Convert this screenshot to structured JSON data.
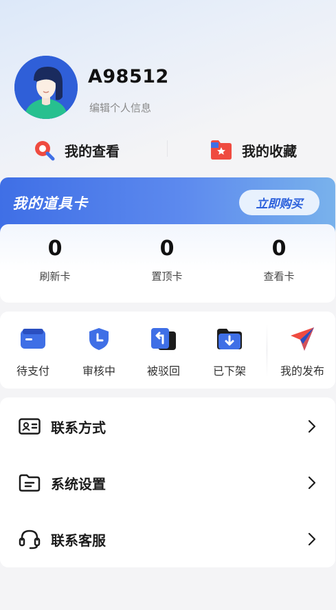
{
  "profile": {
    "username": "A98512",
    "edit_label": "编辑个人信息"
  },
  "quick_links": {
    "views_label": "我的查看",
    "favorites_label": "我的收藏"
  },
  "props": {
    "title": "我的道具卡",
    "buy_label": "立即购买",
    "stats": [
      {
        "value": "0",
        "label": "刷新卡"
      },
      {
        "value": "0",
        "label": "置顶卡"
      },
      {
        "value": "0",
        "label": "查看卡"
      }
    ]
  },
  "orders": {
    "items": [
      {
        "label": "待支付",
        "icon": "wallet-icon"
      },
      {
        "label": "审核中",
        "icon": "shield-clock-icon"
      },
      {
        "label": "被驳回",
        "icon": "return-icon"
      },
      {
        "label": "已下架",
        "icon": "download-folder-icon"
      },
      {
        "label": "我的发布",
        "icon": "paper-plane-icon"
      }
    ]
  },
  "menu": {
    "items": [
      {
        "label": "联系方式",
        "icon": "contact-card-icon"
      },
      {
        "label": "系统设置",
        "icon": "folder-settings-icon"
      },
      {
        "label": "联系客服",
        "icon": "headset-icon"
      }
    ]
  },
  "colors": {
    "accent": "#3f6fe6",
    "background": "#f4f4f6",
    "card": "#ffffff",
    "red": "#ef4b40"
  }
}
